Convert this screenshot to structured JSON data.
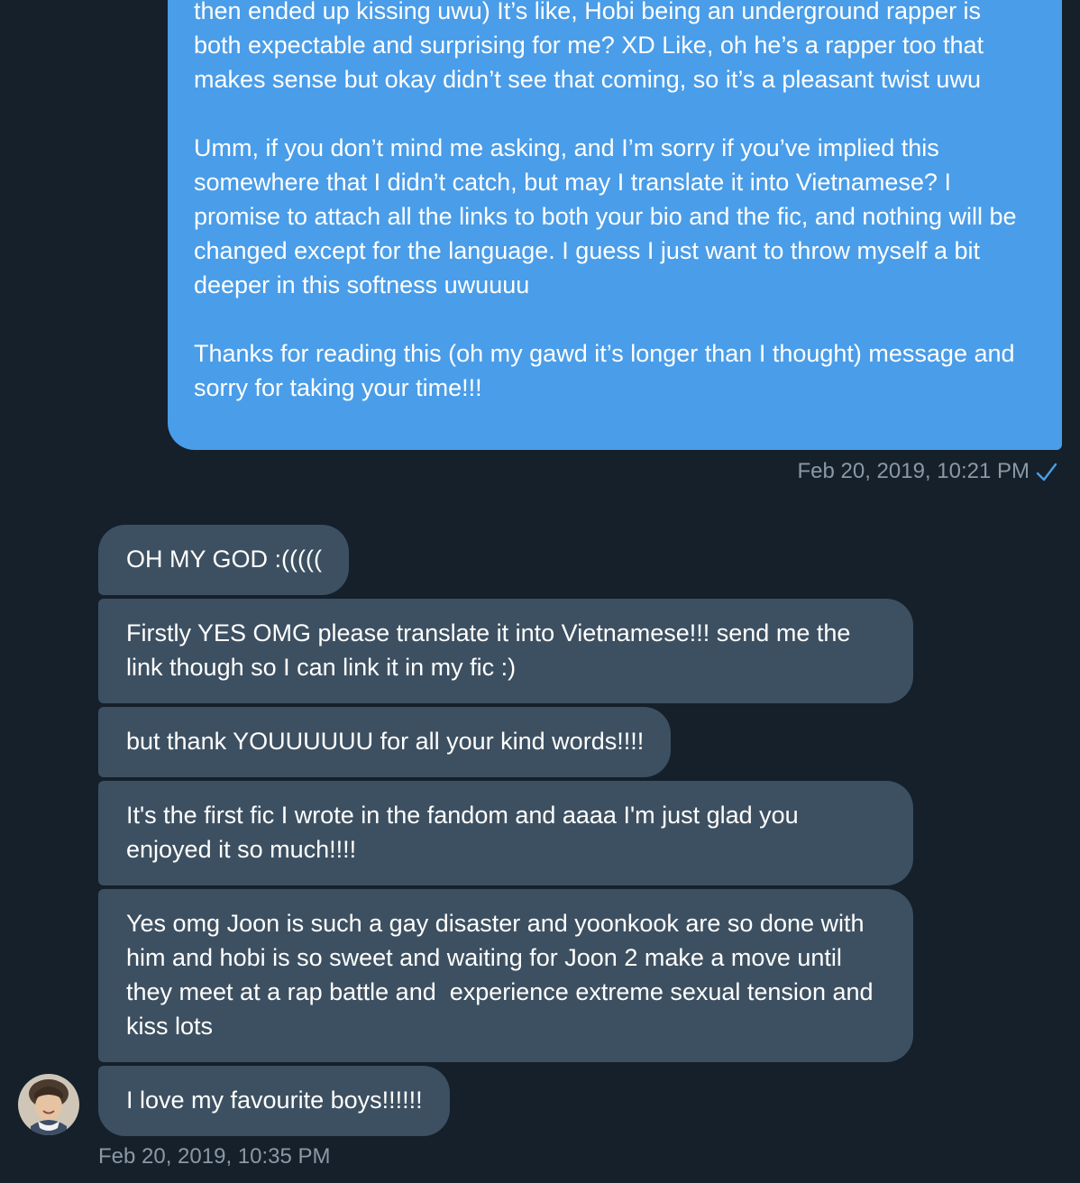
{
  "sent_message": {
    "text": "then ended up kissing uwu) It’s like, Hobi being an underground rapper is both expectable and surprising for me? XD Like, oh he’s a rapper too that makes sense but okay didn’t see that coming, so it’s a pleasant twist uwu\n\nUmm, if you don’t mind me asking, and I’m sorry if you’ve implied this somewhere that I didn’t catch, but may I translate it into Vietnamese? I promise to attach all the links to both your bio and the fic, and nothing will be changed except for the language. I guess I just want to throw myself a bit deeper in this softness uwuuuu\n\nThanks for reading this (oh my gawd it’s longer than I thought) message and sorry for taking your time!!!",
    "timestamp": "Feb 20, 2019, 10:21 PM",
    "read_icon": "checkmark-icon"
  },
  "received_messages": [
    "OH MY GOD :(((((",
    "Firstly YES OMG please translate it into Vietnamese!!! send me the link though so I can link it in my fic :)",
    "but thank YOUUUUUU for all your kind words!!!!",
    "It's the first fic I wrote in the fandom and aaaa I'm just glad you enjoyed it so much!!!!",
    "Yes omg Joon is such a gay disaster and yoonkook are so done with him and hobi is so sweet and waiting for Joon 2 make a move until they meet at a rap battle and  experience extreme sexual tension and kiss lots",
    "I love my favourite boys!!!!!!"
  ],
  "received_timestamp": "Feb 20, 2019, 10:35 PM",
  "colors": {
    "background": "#15202b",
    "sent_bubble": "#4a9de8",
    "received_bubble": "#3d5061",
    "timestamp_text": "#8b98a5",
    "read_check": "#4a9de8"
  }
}
